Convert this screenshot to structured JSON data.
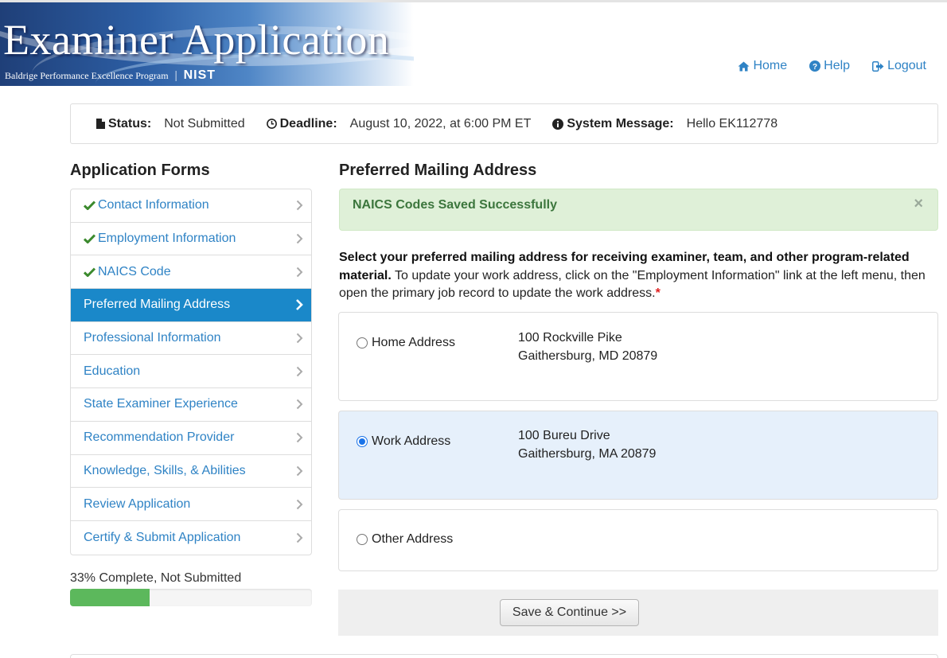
{
  "banner": {
    "title": "Examiner Application",
    "subtitle": "Baldrige Performance Excellence Program",
    "logo": "NIST"
  },
  "topnav": {
    "home": "Home",
    "help": "Help",
    "logout": "Logout"
  },
  "status_bar": {
    "status_label": "Status:",
    "status_value": "Not Submitted",
    "deadline_label": "Deadline:",
    "deadline_value": "August 10, 2022, at 6:00 PM ET",
    "message_label": "System Message:",
    "message_value": "Hello EK112778"
  },
  "sidebar": {
    "title": "Application Forms",
    "items": [
      {
        "label": "Contact Information",
        "completed": true
      },
      {
        "label": "Employment Information",
        "completed": true
      },
      {
        "label": "NAICS Code",
        "completed": true
      },
      {
        "label": "Preferred Mailing Address",
        "active": true
      },
      {
        "label": "Professional Information"
      },
      {
        "label": "Education"
      },
      {
        "label": "State Examiner Experience"
      },
      {
        "label": "Recommendation Provider"
      },
      {
        "label": "Knowledge, Skills, & Abilities"
      },
      {
        "label": "Review Application"
      },
      {
        "label": "Certify & Submit Application"
      }
    ],
    "progress_text": "33% Complete, Not Submitted",
    "progress_fraction": 0.33
  },
  "main": {
    "title": "Preferred Mailing Address",
    "alert_text": "NAICS Codes Saved Successfully",
    "alert_close": "×",
    "instructions_bold": "Select your preferred mailing address for receiving examiner, team, and other program-related material.",
    "instructions_rest": " To update your work address, click on the \"Employment Information\" link at the left menu, then open the primary job record to update the work address.",
    "required_mark": "*",
    "options": [
      {
        "label": "Home Address",
        "line1": "100 Rockville Pike",
        "line2": "Gaithersburg, MD 20879",
        "selected": false
      },
      {
        "label": "Work Address",
        "line1": "100 Bureu Drive",
        "line2": "Gaithersburg, MA 20879",
        "selected": true
      },
      {
        "label": "Other Address",
        "selected": false
      }
    ],
    "save_button": "Save & Continue >>"
  },
  "colors": {
    "link": "#2f83c5",
    "active_menu": "#1a88c9",
    "success_bg": "#dff0d8",
    "success_text": "#3c763d",
    "progress": "#5cb85c",
    "selected_row": "#e6f0fb"
  }
}
